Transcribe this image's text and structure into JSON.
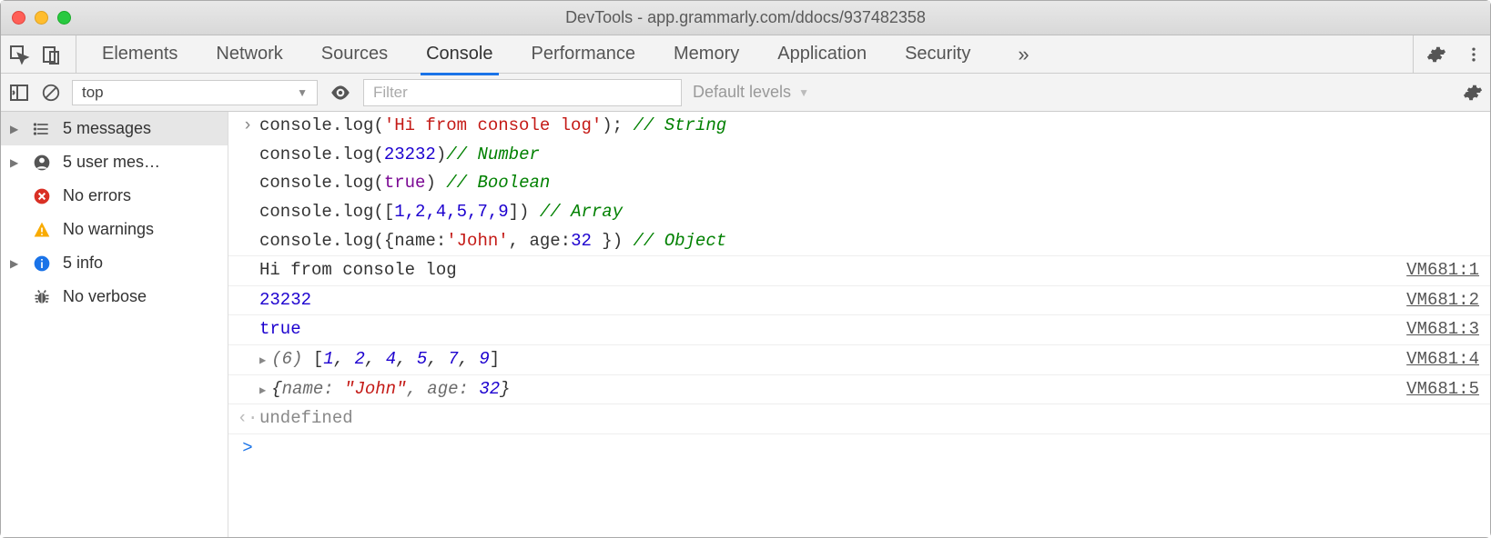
{
  "window": {
    "title": "DevTools - app.grammarly.com/ddocs/937482358"
  },
  "tabs": {
    "items": [
      "Elements",
      "Network",
      "Sources",
      "Console",
      "Performance",
      "Memory",
      "Application",
      "Security"
    ],
    "activeIndex": 3,
    "more": "»"
  },
  "consoleToolbar": {
    "context": "top",
    "filterPlaceholder": "Filter",
    "levels": "Default levels"
  },
  "sidebar": {
    "items": [
      {
        "expandable": true,
        "icon": "list",
        "label": "5 messages",
        "selected": true
      },
      {
        "expandable": true,
        "icon": "user",
        "label": "5 user mes…",
        "selected": false
      },
      {
        "expandable": false,
        "icon": "error",
        "label": "No errors",
        "selected": false
      },
      {
        "expandable": false,
        "icon": "warning",
        "label": "No warnings",
        "selected": false
      },
      {
        "expandable": true,
        "icon": "info",
        "label": "5 info",
        "selected": false
      },
      {
        "expandable": false,
        "icon": "bug",
        "label": "No verbose",
        "selected": false
      }
    ]
  },
  "input": {
    "lines": [
      {
        "pre": "console.log(",
        "str": "'Hi from console log'",
        "post": "); ",
        "cmt": "// String"
      },
      {
        "pre": "console.log(",
        "num": "23232",
        "post": ")",
        "cmt": "// Number"
      },
      {
        "pre": "console.log(",
        "bool": "true",
        "post": ") ",
        "cmt": "// Boolean"
      },
      {
        "pre": "console.log([",
        "nums": "1,2,4,5,7,9",
        "post": "]) ",
        "cmt": "// Array"
      },
      {
        "pre": "console.log({name:",
        "str": "'John'",
        "mid": ", age:",
        "num": "32",
        "post": " }) ",
        "cmt": "// Object"
      }
    ]
  },
  "output": [
    {
      "type": "text",
      "text": "Hi from console log",
      "src": "VM681:1"
    },
    {
      "type": "number",
      "text": "23232",
      "src": "VM681:2"
    },
    {
      "type": "bool",
      "text": "true",
      "src": "VM681:3"
    },
    {
      "type": "array",
      "len": "(6)",
      "vals": [
        "1",
        "2",
        "4",
        "5",
        "7",
        "9"
      ],
      "src": "VM681:4"
    },
    {
      "type": "object",
      "name": "John",
      "age": "32",
      "src": "VM681:5"
    }
  ],
  "result": "undefined",
  "labels": {
    "obj_name_key": "name: ",
    "obj_age_key": ", age: ",
    "arr_open": "[",
    "arr_close": "]",
    "obj_open": "{",
    "obj_close": "}",
    "comma": ", ",
    "prompt": ">"
  }
}
